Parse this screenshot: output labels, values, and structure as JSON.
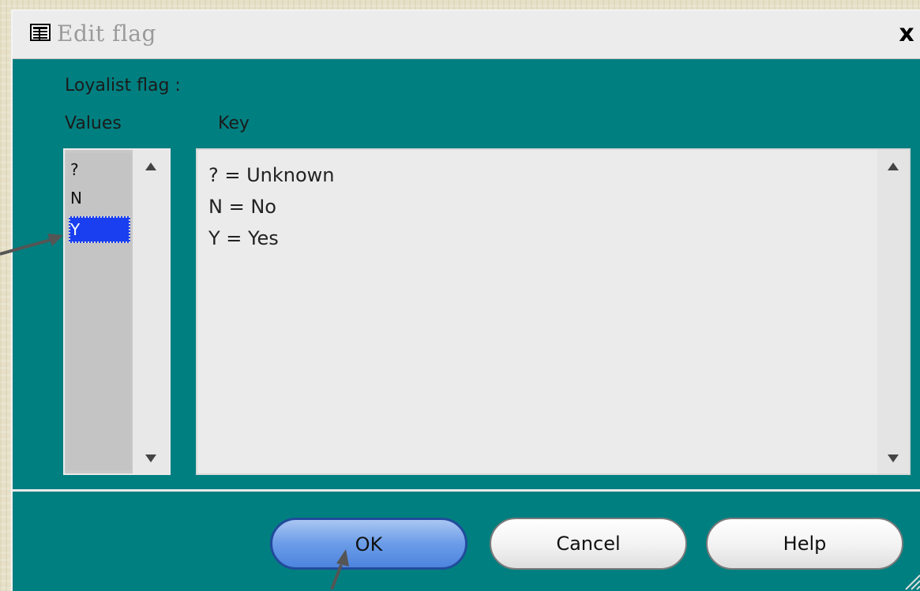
{
  "window": {
    "title": "Edit flag",
    "close_label": "x"
  },
  "field": {
    "label": "Loyalist flag :"
  },
  "columns": {
    "values_header": "Values",
    "key_header": "Key"
  },
  "values_list": {
    "items": [
      "?",
      "N",
      "Y"
    ],
    "selected": "Y"
  },
  "key_text": {
    "lines": [
      "? = Unknown",
      "N = No",
      "Y = Yes"
    ]
  },
  "buttons": {
    "ok": "OK",
    "cancel": "Cancel",
    "help": "Help"
  },
  "colors": {
    "dialog_bg": "#007f80",
    "selection": "#1a3ff0",
    "ok_button": "#6b9ce8"
  },
  "icons": [
    "table-icon",
    "close-icon",
    "scroll-up-icon",
    "scroll-down-icon",
    "resize-grip-icon",
    "annotation-arrow"
  ]
}
